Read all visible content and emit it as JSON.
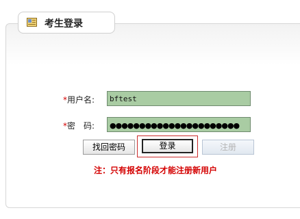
{
  "header": {
    "title": "考生登录",
    "icon": "exam-login-icon"
  },
  "form": {
    "username": {
      "required_mark": "*",
      "label": "用户名:",
      "value": "bftest"
    },
    "password": {
      "required_mark": "*",
      "label": "密　码:",
      "masked_value": "●●●●●●●●●●●●●●●●●●●●●●"
    }
  },
  "buttons": {
    "retrieve_password": "找回密码",
    "login": "登录",
    "register": "注册"
  },
  "notice": "注：只有报名阶段才能注册新用户",
  "colors": {
    "field_bg": "#a9cca3",
    "required": "#d40000",
    "notice": "#d40000",
    "focus_outline": "#cc2a2a"
  }
}
